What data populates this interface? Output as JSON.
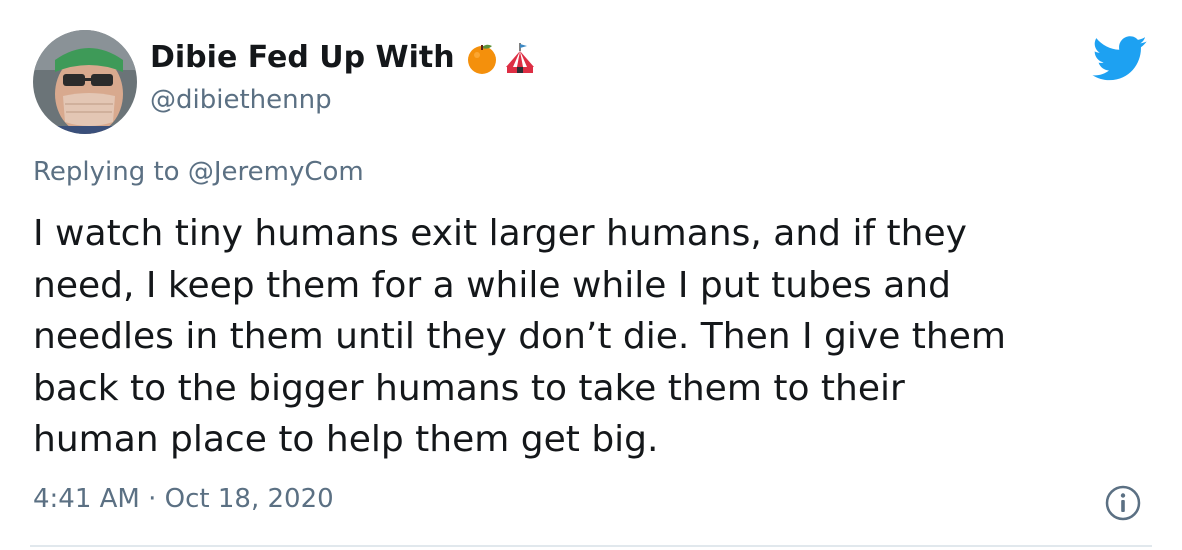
{
  "tweet": {
    "author": {
      "display_name": "Dibie Fed Up With",
      "name_emojis": [
        "orange-emoji",
        "circus-tent-emoji"
      ],
      "handle": "@dibiethennp",
      "avatar_icon": "user-avatar-photo"
    },
    "reply": {
      "prefix": "Replying to",
      "mention": "@JeremyCom"
    },
    "text": "I watch tiny humans exit larger humans, and if they\nneed, I keep them for a while while I put tubes and\nneedles in them until they don’t die. Then I give them\nback to the bigger humans to take them to their\nhuman place to help them get big.",
    "timestamp": "4:41 AM · Oct 18, 2020",
    "platform_icon": "twitter-bird-icon",
    "info_icon": "info-icon",
    "colors": {
      "brand_blue": "#1da1f2",
      "secondary_text": "#5b7083",
      "primary_text": "#14171a"
    }
  }
}
